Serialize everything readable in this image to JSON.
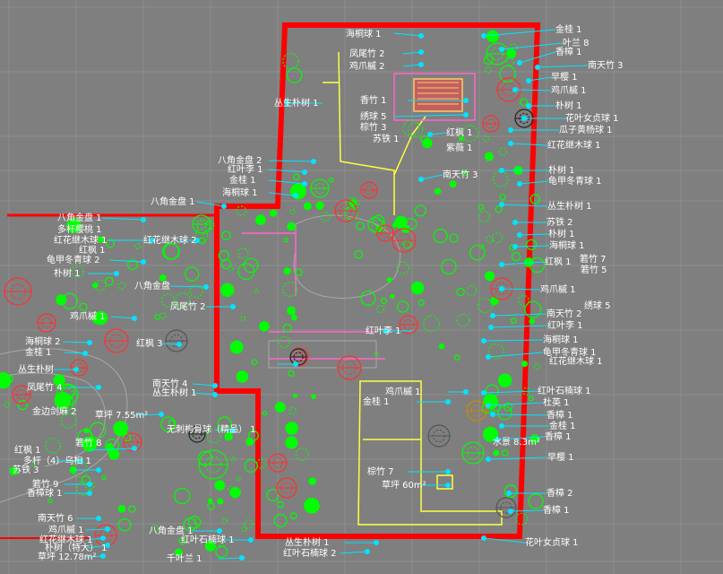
{
  "colors": {
    "background": "#7f7f7f",
    "grid": "#8c8c8c",
    "boundary": "#ff0000",
    "leader": "#00e5ff",
    "plant": "#00ff00",
    "path": "#ffff00",
    "structure": "#ff80c0"
  },
  "labels": [
    {
      "id": "l01",
      "text": "金桂 1"
    },
    {
      "id": "l02",
      "text": "叶兰 8"
    },
    {
      "id": "l03",
      "text": "香樟 1"
    },
    {
      "id": "l04",
      "text": "南天竹 3"
    },
    {
      "id": "l05",
      "text": "早樱 1"
    },
    {
      "id": "l06",
      "text": "鸡爪槭 1"
    },
    {
      "id": "l07",
      "text": "朴树 1"
    },
    {
      "id": "l08",
      "text": "花叶女贞球 1"
    },
    {
      "id": "l09",
      "text": "瓜子黄杨球 1"
    },
    {
      "id": "l10",
      "text": "红花继木球 1"
    },
    {
      "id": "l11",
      "text": "朴树 1"
    },
    {
      "id": "l12",
      "text": "龟甲冬青球 1"
    },
    {
      "id": "l13",
      "text": "丛生朴树 1"
    },
    {
      "id": "l14",
      "text": "苏铁 2"
    },
    {
      "id": "l15",
      "text": "朴树 1"
    },
    {
      "id": "l16",
      "text": "海桐球 1"
    },
    {
      "id": "l17",
      "text": "箬竹 7"
    },
    {
      "id": "l18",
      "text": "红枫 1"
    },
    {
      "id": "l19",
      "text": "箬竹 5"
    },
    {
      "id": "l20",
      "text": "鸡爪槭 1"
    },
    {
      "id": "l21",
      "text": "绣球 5"
    },
    {
      "id": "l22",
      "text": "南天竹 2"
    },
    {
      "id": "l23",
      "text": "红叶李 1"
    },
    {
      "id": "l24",
      "text": "海桐球 1"
    },
    {
      "id": "l25",
      "text": "龟甲冬青球 1"
    },
    {
      "id": "l26",
      "text": "红花继木球 1"
    },
    {
      "id": "l27",
      "text": "红叶石楠球 1"
    },
    {
      "id": "l28",
      "text": "杜英 1"
    },
    {
      "id": "l29",
      "text": "香樟 1"
    },
    {
      "id": "l30",
      "text": "金桂 1"
    },
    {
      "id": "l31",
      "text": "香樟 1"
    },
    {
      "id": "l32",
      "text": "早樱 1"
    },
    {
      "id": "l33",
      "text": "香樟 2"
    },
    {
      "id": "l34",
      "text": "香樟 1"
    },
    {
      "id": "l35",
      "text": "花叶女贞球 1"
    },
    {
      "id": "l36",
      "text": "海桐球 1"
    },
    {
      "id": "l37",
      "text": "鸡爪槭 2"
    },
    {
      "id": "l38",
      "text": "凤尾竹 2"
    },
    {
      "id": "l39",
      "text": "香竹 1"
    },
    {
      "id": "l40",
      "text": "绣球 5"
    },
    {
      "id": "l41",
      "text": "棕竹 3"
    },
    {
      "id": "l42",
      "text": "苏铁 1"
    },
    {
      "id": "l43",
      "text": "红枫 1"
    },
    {
      "id": "l44",
      "text": "紫薇 1"
    },
    {
      "id": "l45",
      "text": "南天竹 3"
    },
    {
      "id": "l46",
      "text": "八角金盘 2"
    },
    {
      "id": "l47",
      "text": "红叶李 1"
    },
    {
      "id": "l48",
      "text": "金桂 1"
    },
    {
      "id": "l49",
      "text": "海桐球 1"
    },
    {
      "id": "l50",
      "text": "八角金盘 1"
    },
    {
      "id": "l51",
      "text": "八角金盘 1"
    },
    {
      "id": "l52",
      "text": "多杆樱桃 1"
    },
    {
      "id": "l53",
      "text": "红花继木球 1"
    },
    {
      "id": "l54",
      "text": "红花继木球 2"
    },
    {
      "id": "l55",
      "text": "红枫 1"
    },
    {
      "id": "l56",
      "text": "龟甲冬青球 2"
    },
    {
      "id": "l57",
      "text": "朴树 1"
    },
    {
      "id": "l58",
      "text": "八角金盘"
    },
    {
      "id": "l59",
      "text": "鸡爪槭 1"
    },
    {
      "id": "l60",
      "text": "凤尾竹 2"
    },
    {
      "id": "l61",
      "text": "海桐球 2"
    },
    {
      "id": "l62",
      "text": "金桂 1"
    },
    {
      "id": "l63",
      "text": "红枫 3"
    },
    {
      "id": "l64",
      "text": "丛生朴树"
    },
    {
      "id": "l65",
      "text": "凤尾竹 4"
    },
    {
      "id": "l66",
      "text": "南天竹 4"
    },
    {
      "id": "l67",
      "text": "丛生朴树 1"
    },
    {
      "id": "l68",
      "text": "草坪 7.55m²"
    },
    {
      "id": "l69",
      "text": "金边剑麻 2"
    },
    {
      "id": "l70",
      "text": "无刺枸骨球（精品） 1"
    },
    {
      "id": "l71",
      "text": "红枫 1"
    },
    {
      "id": "l72",
      "text": "箬竹 8"
    },
    {
      "id": "l73",
      "text": "多杆（4）乌桕 1"
    },
    {
      "id": "l74",
      "text": "苏铁 3"
    },
    {
      "id": "l75",
      "text": "箬竹 9"
    },
    {
      "id": "l76",
      "text": "香樟球 1"
    },
    {
      "id": "l77",
      "text": "南天竹 6"
    },
    {
      "id": "l78",
      "text": "鸡爪槭 1"
    },
    {
      "id": "l79",
      "text": "红花继木球 1"
    },
    {
      "id": "l80",
      "text": "朴树（特大） 1"
    },
    {
      "id": "l81",
      "text": "草坪 12.78m²"
    },
    {
      "id": "l82",
      "text": "千叶兰 1"
    },
    {
      "id": "l83",
      "text": "八角金盘 1"
    },
    {
      "id": "l84",
      "text": "红叶石楠球 1"
    },
    {
      "id": "l85",
      "text": "丛生朴树 1"
    },
    {
      "id": "l86",
      "text": "红叶石楠球 2"
    },
    {
      "id": "l87",
      "text": "鸡爪槭 1"
    },
    {
      "id": "l88",
      "text": "金桂 1"
    },
    {
      "id": "l89",
      "text": "棕竹 7"
    },
    {
      "id": "l90",
      "text": "草坪 60m²"
    },
    {
      "id": "l91",
      "text": "水景 8.3m²"
    },
    {
      "id": "l92",
      "text": "丛生朴树 1"
    },
    {
      "id": "l93",
      "text": "红叶李 1"
    }
  ],
  "ui": {
    "title_hidden": ""
  }
}
